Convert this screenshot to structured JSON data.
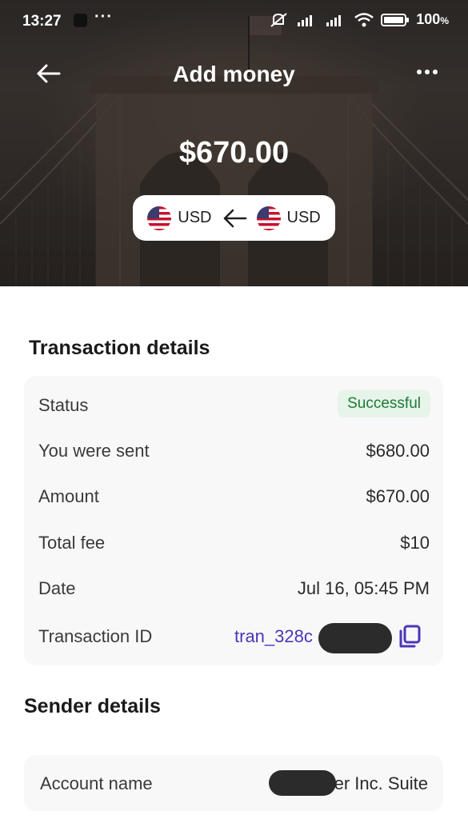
{
  "status_bar": {
    "time": "13:27",
    "dots": "···",
    "battery": "100"
  },
  "header": {
    "title": "Add money",
    "back_icon": "arrow-left-icon",
    "more_icon": "more-horizontal-icon"
  },
  "hero": {
    "amount": "$670.00",
    "from_currency": "USD",
    "to_currency": "USD",
    "from_flag": "us-flag-icon",
    "to_flag": "us-flag-icon",
    "direction_icon": "arrow-left-icon"
  },
  "transaction_details": {
    "title": "Transaction details",
    "rows": [
      {
        "label": "Status",
        "value": "Successful"
      },
      {
        "label": "You were sent",
        "value": "$680.00"
      },
      {
        "label": "Amount",
        "value": "$670.00"
      },
      {
        "label": "Total fee",
        "value": "$10"
      },
      {
        "label": "Date",
        "value": "Jul 16, 05:45 PM"
      },
      {
        "label": "Transaction ID",
        "value": "tran_328c"
      }
    ]
  },
  "sender_details": {
    "title": "Sender details",
    "rows": [
      {
        "label": "Account name",
        "value": "er Inc. Suite"
      }
    ]
  },
  "colors": {
    "link": "#4b36b8",
    "success_bg": "#e6f4ea",
    "success_text": "#1e7b34"
  }
}
